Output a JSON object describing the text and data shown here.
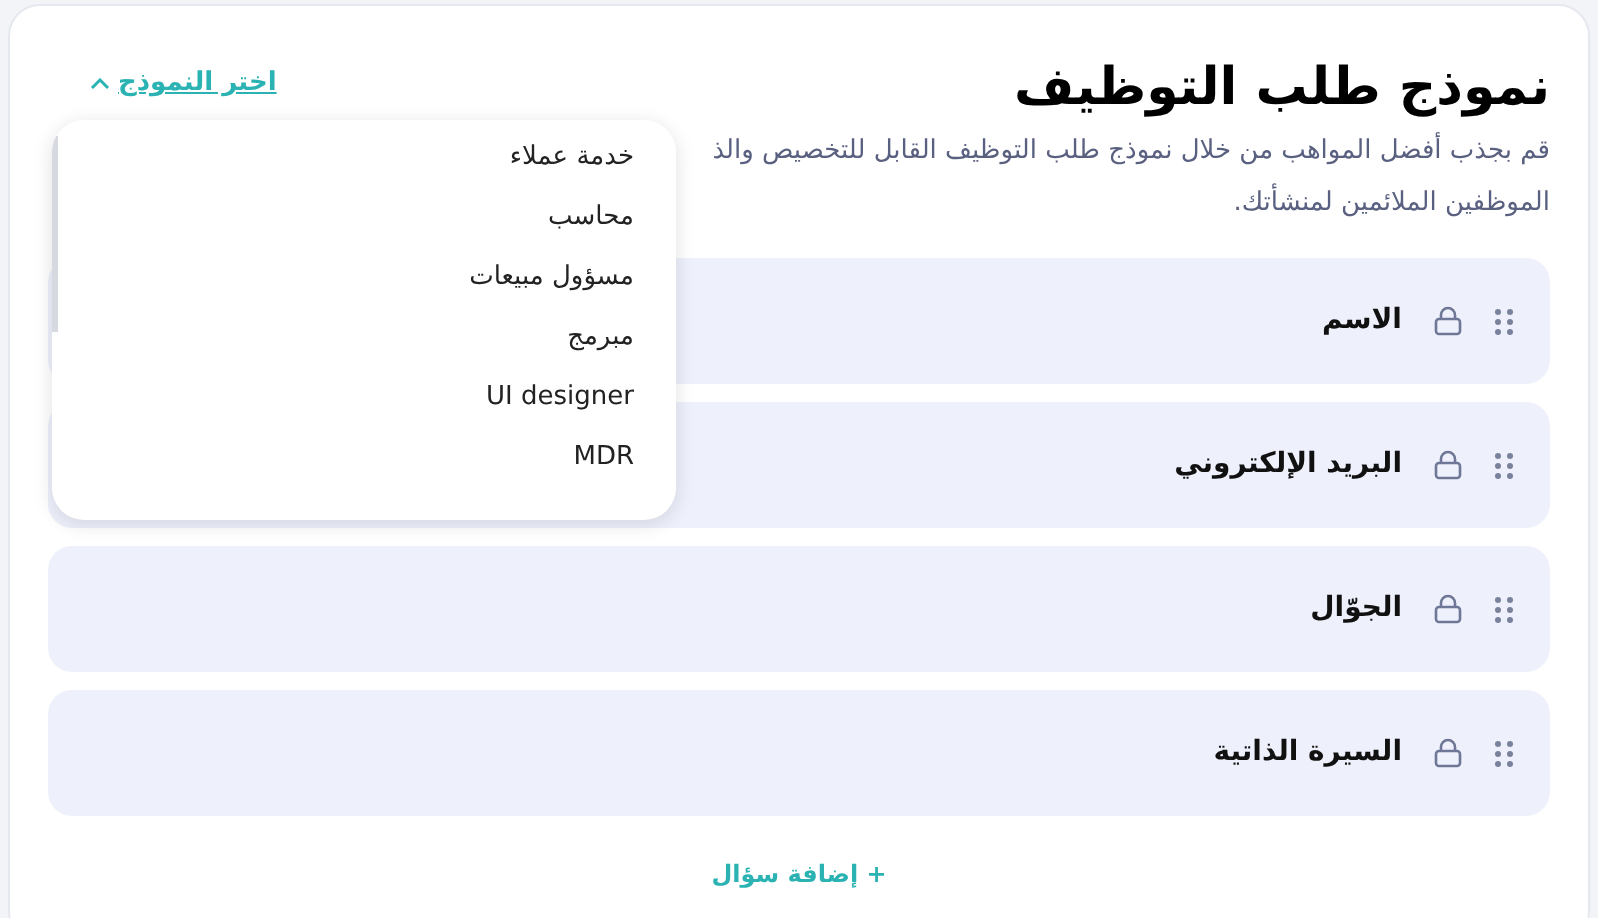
{
  "title": "نموذج طلب التوظيف",
  "description_lines": [
    "قم بجذب أفضل المواهب من خلال نموذج طلب التوظيف القابل للتخصيص والذ",
    "الموظفين الملائمين لمنشأتك."
  ],
  "template_picker": {
    "label": "اختر النموذج",
    "expanded": true,
    "options": [
      "خدمة عملاء",
      "محاسب",
      "مسؤول مبيعات",
      "مبرمج",
      "UI designer",
      "MDR"
    ]
  },
  "fields": [
    {
      "label": "الاسم",
      "locked": true
    },
    {
      "label": "البريد الإلكتروني",
      "locked": true
    },
    {
      "label": "الجوّال",
      "locked": true
    },
    {
      "label": "السيرة الذاتية",
      "locked": true
    }
  ],
  "add_question": "+ إضافة سؤال"
}
